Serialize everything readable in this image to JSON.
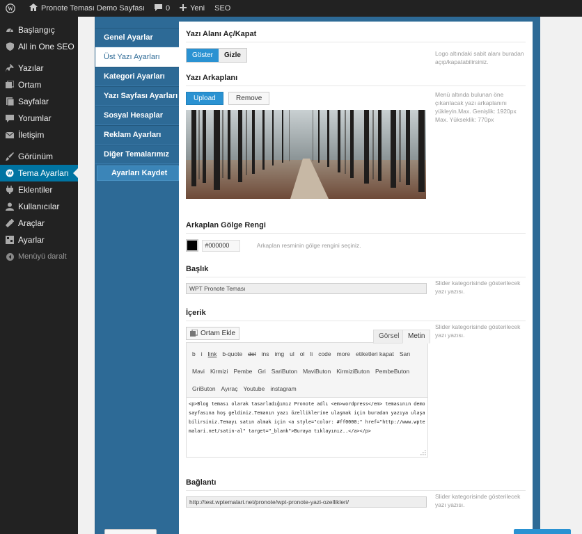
{
  "adminbar": {
    "site_name": "Pronote Teması Demo Sayfası",
    "comments_count": "0",
    "new_label": "Yeni",
    "seo_label": "SEO"
  },
  "menu": {
    "items": [
      {
        "label": "Başlangıç",
        "icon": "dashboard-icon"
      },
      {
        "label": "All in One SEO",
        "icon": "shield-icon"
      },
      {
        "label": "Yazılar",
        "icon": "pin-icon"
      },
      {
        "label": "Ortam",
        "icon": "media-icon"
      },
      {
        "label": "Sayfalar",
        "icon": "page-icon"
      },
      {
        "label": "Yorumlar",
        "icon": "comment-icon"
      },
      {
        "label": "İletişim",
        "icon": "mail-icon"
      },
      {
        "label": "Görünüm",
        "icon": "brush-icon"
      },
      {
        "label": "Tema Ayarları",
        "icon": "theme-icon"
      },
      {
        "label": "Eklentiler",
        "icon": "plugin-icon"
      },
      {
        "label": "Kullanıcılar",
        "icon": "user-icon"
      },
      {
        "label": "Araçlar",
        "icon": "wrench-icon"
      },
      {
        "label": "Ayarlar",
        "icon": "settings-icon"
      }
    ],
    "collapse_label": "Menüyü daralt"
  },
  "tabs": [
    "Genel Ayarlar",
    "Üst Yazı Ayarları",
    "Kategori Ayarları",
    "Yazı Sayfası Ayarları",
    "Sosyal Hesaplar",
    "Reklam Ayarları",
    "Diğer Temalarımız"
  ],
  "save_label": "Ayarları Kaydet",
  "sections": {
    "toggle": {
      "title": "Yazı Alanı Aç/Kapat",
      "on_label": "Göster",
      "off_label": "Gizle",
      "desc": "Logo altındaki sabit alanı buradan açıp/kapatabilirsiniz."
    },
    "background": {
      "title": "Yazı Arkaplanı",
      "upload_label": "Upload",
      "remove_label": "Remove",
      "desc": "Menü altında bulunan öne çıkarılacak yazı arkaplanını yükleyin.Max. Genişlik: 1920px Max. Yükseklik: 770px"
    },
    "shadow": {
      "title": "Arkaplan Gölge Rengi",
      "color": "#000000",
      "desc": "Arkaplan resminin gölge rengini seçiniz."
    },
    "heading": {
      "title": "Başlık",
      "value": "WPT Pronote Teması",
      "desc": "Slider kategorisinde gösterilecek yazı yazısı."
    },
    "content": {
      "title": "İçerik",
      "media_label": "Ortam Ekle",
      "visual_tab": "Görsel",
      "text_tab": "Metin",
      "desc": "Slider kategorisinde gösterilecek yazı yazısı.",
      "toolbar_row1": [
        "b",
        "i",
        "link",
        "b-quote",
        "del",
        "ins",
        "img",
        "ul",
        "ol",
        "li",
        "code",
        "more",
        "etiketleri kapat",
        "Sarı"
      ],
      "toolbar_row2": [
        "Mavi",
        "Kirmizi",
        "Pembe",
        "Gri",
        "SariButon",
        "MaviButon",
        "KirmiziButon",
        "PembeButon"
      ],
      "toolbar_row3": [
        "GriButon",
        "Ayıraç",
        "Youtube",
        "instagram"
      ],
      "body": "<p>Blog teması olarak tasarladığımız Pronote adlı <em>wordpress</em> temasının demo sayfasına hoş geldiniz.Temanın yazı özelliklerine ulaşmak için buradan yazıya ulaşabilirsiniz.Temayı satın almak için <a style=\"color: #ff0000;\" href=\"http://www.wptemalari.net/satin-al\" target=\"_blank\">Buraya tıklayınız..</a></p>"
    },
    "link": {
      "title": "Bağlantı",
      "value": "http://test.wptemalari.net/pronote/wpt-pronote-yazi-ozellikleri/",
      "desc": "Slider kategorisinde gösterilecek yazı yazısı."
    }
  },
  "colors": {
    "admin_bg": "#222222",
    "accent": "#0074a2",
    "panel_bg": "#2d6a96",
    "button_blue": "#2a92d2"
  }
}
